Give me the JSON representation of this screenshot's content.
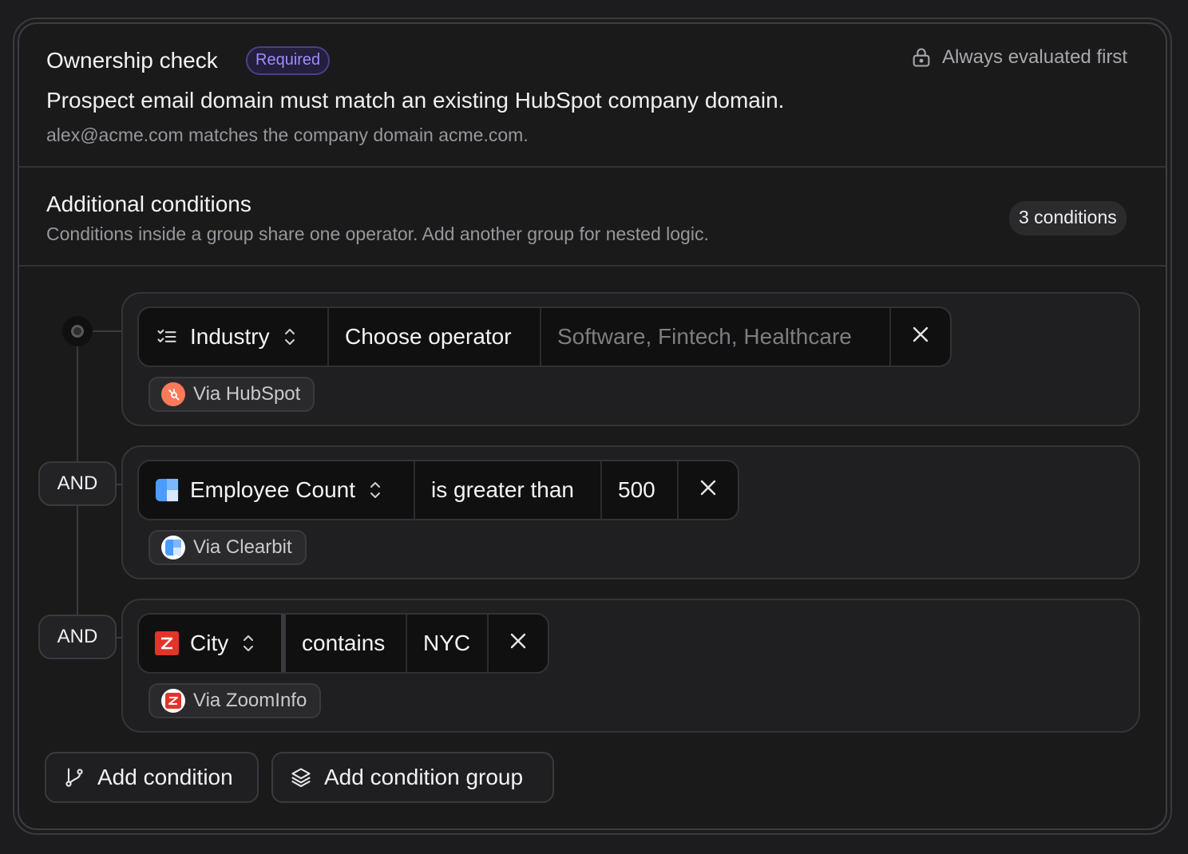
{
  "ownership": {
    "title": "Ownership check",
    "badge": "Required",
    "lock_note": "Always evaluated first",
    "description": "Prospect email domain must match an existing HubSpot company domain.",
    "example": "alex@acme.com matches the company domain acme.com."
  },
  "additional": {
    "title": "Additional conditions",
    "subtitle": "Conditions inside a group share one operator. Add another group for nested logic.",
    "count_badge": "3 conditions"
  },
  "conditions": [
    {
      "field": "Industry",
      "field_icon": "list-check-icon",
      "operator": "Choose operator",
      "value_placeholder": "Software, Fintech, Healthcare",
      "source": "Via HubSpot",
      "source_icon": "hubspot-icon",
      "connector": ""
    },
    {
      "field": "Employee Count",
      "field_icon": "clearbit-icon",
      "operator": "is greater than",
      "value": "500",
      "source": "Via Clearbit",
      "source_icon": "clearbit-icon",
      "connector": "AND"
    },
    {
      "field": "City",
      "field_icon": "zoominfo-icon",
      "operator": "contains",
      "value": "NYC",
      "source": "Via ZoomInfo",
      "source_icon": "zoominfo-icon",
      "connector": "AND"
    }
  ],
  "actions": {
    "add_condition": "Add condition",
    "add_group": "Add condition group"
  },
  "colors": {
    "background": "#1a1a1b",
    "badge_text": "#9f8cff",
    "hubspot": "#ff7a59",
    "clearbit": "#4a9cff",
    "zoominfo": "#e2352a"
  }
}
